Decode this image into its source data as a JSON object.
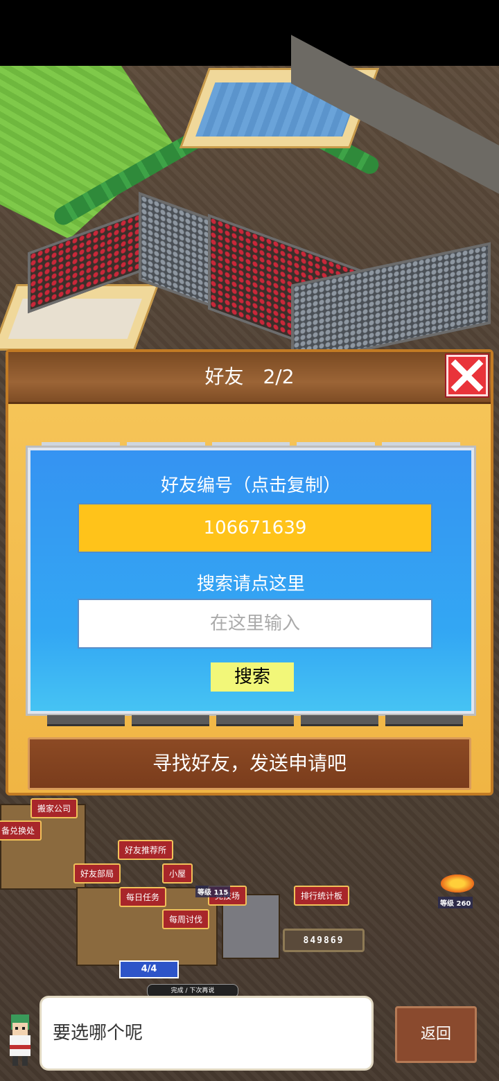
{
  "dialog": {
    "title": "好友　2/2",
    "id_label": "好友编号（点击复制）",
    "friend_id": "106671639",
    "search_label": "搜索请点这里",
    "search_placeholder": "在这里输入",
    "search_button": "搜索",
    "find_button": "寻找好友，发送申请吧"
  },
  "town": {
    "tags": {
      "moving_company": "搬家公司",
      "exchange": "备兑换处",
      "friend_recommend": "好友推荐所",
      "friend_department": "好友部局",
      "cabin": "小屋",
      "daily_tasks": "每日任务",
      "arena": "竞技场",
      "weekly_subjugation": "每周讨伐",
      "ranking_board": "排行统计板"
    },
    "level_near_arena": "等级 115",
    "level_right": "等级 260",
    "score": "849869",
    "progress": "4/4",
    "complete_bar": "完成 / 下次再说"
  },
  "chat": {
    "message": "要选哪个呢",
    "back_button": "返回"
  }
}
